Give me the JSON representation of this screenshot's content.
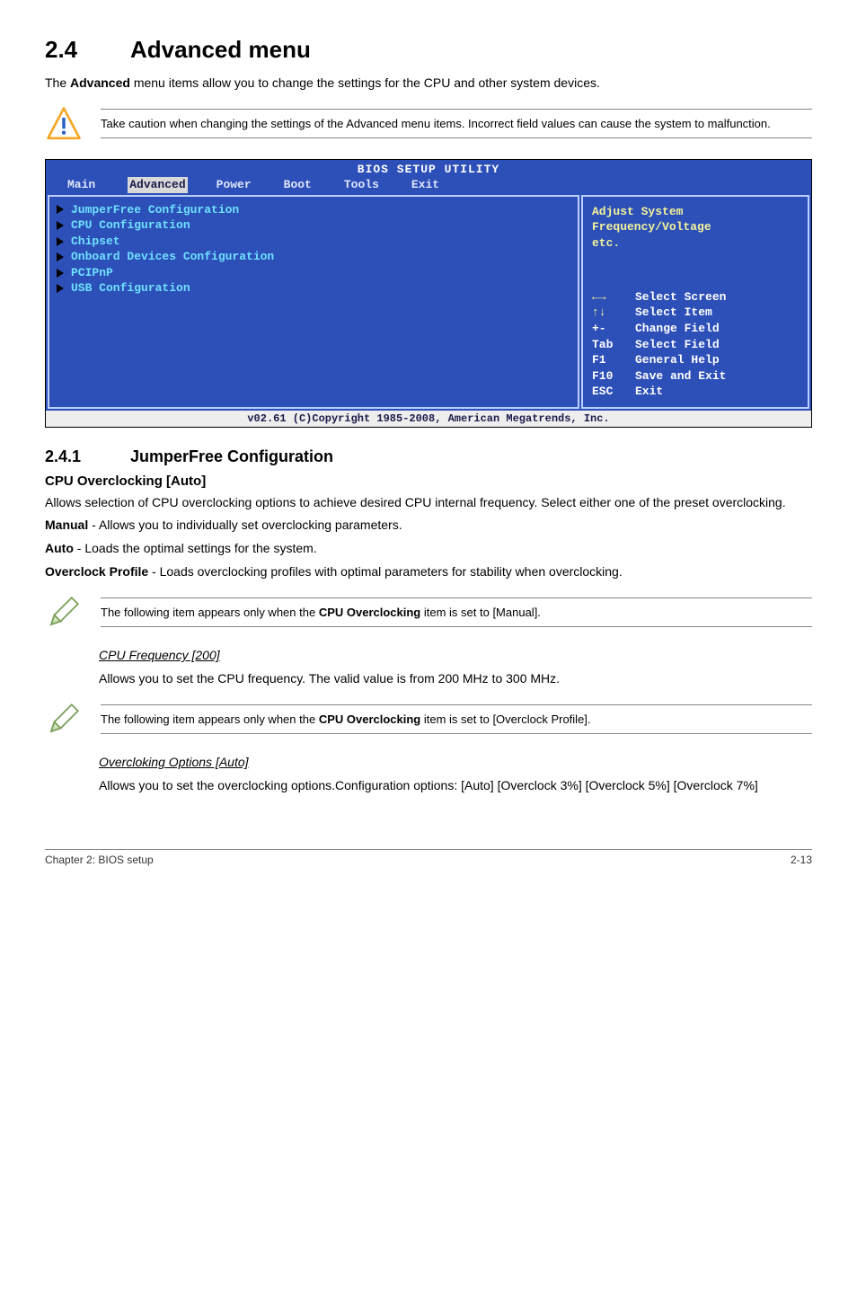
{
  "heading": {
    "num": "2.4",
    "title": "Advanced menu"
  },
  "intro_prefix": "The ",
  "intro_bold": "Advanced",
  "intro_suffix": " menu items allow you to change the settings for the CPU and other system devices.",
  "callout1": "Take caution when changing the settings of the Advanced menu items. Incorrect field values can cause the system to malfunction.",
  "bios": {
    "title": "BIOS SETUP UTILITY",
    "menus": [
      "Main",
      "Advanced",
      "Power",
      "Boot",
      "Tools",
      "Exit"
    ],
    "left_items": [
      "JumperFree Configuration",
      "CPU Configuration",
      "Chipset",
      "Onboard Devices Configuration",
      "PCIPnP",
      "USB Configuration"
    ],
    "right_top": [
      "Adjust System",
      "Frequency/Voltage",
      "etc."
    ],
    "right_keys": [
      {
        "k": "←→",
        "v": "Select Screen"
      },
      {
        "k": "↑↓",
        "v": "Select Item"
      },
      {
        "k": "+-",
        "v": "Change Field"
      },
      {
        "k": "Tab",
        "v": "Select Field"
      },
      {
        "k": "F1",
        "v": "General Help"
      },
      {
        "k": "F10",
        "v": "Save and Exit"
      },
      {
        "k": "ESC",
        "v": "Exit"
      }
    ],
    "footer": "v02.61 (C)Copyright 1985-2008, American Megatrends, Inc."
  },
  "sub": {
    "num": "2.4.1",
    "title": "JumperFree Configuration"
  },
  "cpu_oc_heading": "CPU Overclocking [Auto]",
  "cpu_oc_p1": "Allows selection of CPU overclocking options to achieve desired CPU internal frequency. Select either one of the preset overclocking.",
  "manual_label": "Manual",
  "manual_text": " - Allows you to individually set overclocking parameters.",
  "auto_label": "Auto",
  "auto_text": " - Loads the optimal settings for the system.",
  "ocp_label": "Overclock Profile",
  "ocp_text": " - Loads overclocking profiles with optimal parameters for stability when overclocking.",
  "callout2_prefix": "The following item appears only when the ",
  "callout2_bold": "CPU Overclocking",
  "callout2_suffix": " item is set to [Manual].",
  "cpufreq_heading": "CPU Frequency [200]",
  "cpufreq_text": "Allows you to set the CPU frequency. The valid value is from 200 MHz to 300 MHz.",
  "callout3_prefix": "The following item appears only when the ",
  "callout3_bold": "CPU Overclocking",
  "callout3_suffix": " item is set to [Overclock Profile].",
  "ocopt_heading": "Overcloking Options [Auto]",
  "ocopt_text": "Allows you to set the overclocking options.Configuration options: [Auto] [Overclock 3%] [Overclock 5%] [Overclock 7%]",
  "footer_left": "Chapter 2: BIOS setup",
  "footer_right": "2-13"
}
